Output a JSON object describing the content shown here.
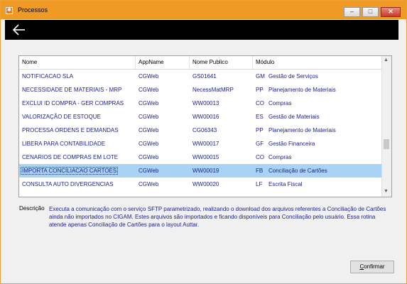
{
  "window": {
    "title": "Processos",
    "app_icon_glyph": "✱",
    "controls": {
      "minimize": "–",
      "maximize": "□",
      "close": "✕"
    }
  },
  "topbar": {
    "back_icon": "back-arrow-icon"
  },
  "grid": {
    "columns": [
      "Nome",
      "AppName",
      "Nome Publico",
      "Módulo"
    ],
    "rows": [
      {
        "nome": "NOTIFICACAO SLA",
        "app": "CGWeb",
        "publico": "GS01641",
        "mod_code": "GM",
        "mod_name": "Gestão de Serviços"
      },
      {
        "nome": "NECESSIDADE DE MATERIAIS - MRP",
        "app": "CGWeb",
        "publico": "NecessMatMRP",
        "mod_code": "PP",
        "mod_name": "Planejamento de Materiais"
      },
      {
        "nome": "EXCLUI ID COMPRA - GER COMPRAS",
        "app": "CGWeb",
        "publico": "WW00013",
        "mod_code": "CO",
        "mod_name": "Compras"
      },
      {
        "nome": "VALORIZAÇÃO DE ESTOQUE",
        "app": "CGWeb",
        "publico": "WW00016",
        "mod_code": "ES",
        "mod_name": "Gestão de Materiais"
      },
      {
        "nome": "PROCESSA ORDENS E DEMANDAS",
        "app": "CGWeb",
        "publico": "CG06343",
        "mod_code": "PP",
        "mod_name": "Planejamento de Materiais"
      },
      {
        "nome": "LIBERA PARA CONTABILIDADE",
        "app": "CGWeb",
        "publico": "WW00017",
        "mod_code": "GF",
        "mod_name": "Gestão Financeira"
      },
      {
        "nome": "CENARIOS DE COMPRAS EM LOTE",
        "app": "CGWeb",
        "publico": "WW00015",
        "mod_code": "CO",
        "mod_name": "Compras"
      },
      {
        "nome": "IMPORTA CONCILIACAO CARTOES",
        "app": "CGWeb",
        "publico": "WW00019",
        "mod_code": "FB",
        "mod_name": "Conciliação de Cartões",
        "selected": true
      },
      {
        "nome": "CONSULTA AUTO DIVERGENCIAS",
        "app": "CGWeb",
        "publico": "WW00020",
        "mod_code": "LF",
        "mod_name": "Escrita Fiscal"
      }
    ]
  },
  "description": {
    "label": "Descrição",
    "text": "Executa a comunicação com o serviço SFTP parametrizado, realizando o download dos arquivos referentes a Conciliação de Cartões ainda não importados no CIGAM. Estes arquivos são importados e ficando disponíveis para Conciliação pelo usuário. Essa rotina atende apenas Conciliação de Cartões para o layout Auttar."
  },
  "buttons": {
    "confirm_first": "C",
    "confirm_rest": "onfirmar"
  },
  "colors": {
    "titlebar": "#ef9a24",
    "selected_row": "#a9d3f5",
    "text_blue": "#1d1d8c"
  }
}
